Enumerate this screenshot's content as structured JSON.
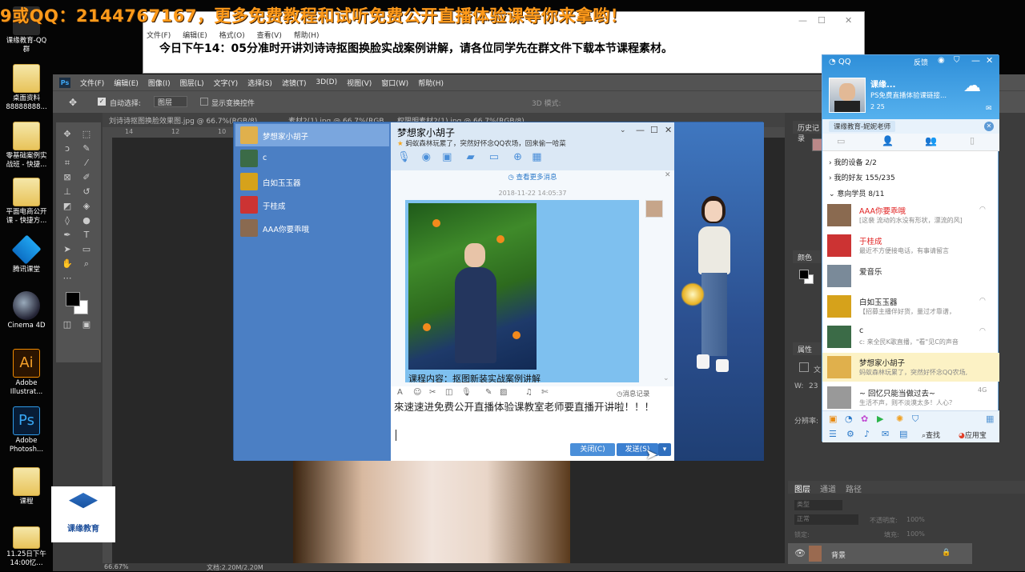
{
  "banner": "9或QQ：2144767167，更多免费教程和试听免费公开直播体验课等你来拿哟！",
  "desktop": {
    "icons": [
      {
        "label": "课缘教育-QQ群"
      },
      {
        "label": "桌面资料88888888..."
      },
      {
        "label": "零基础案例实战班 - 快捷..."
      },
      {
        "label": "平面电商公开课 - 快捷方..."
      },
      {
        "label": "腾讯课堂"
      },
      {
        "label": "Cinema 4D"
      },
      {
        "label": "Adobe Illustrat..."
      },
      {
        "label": "Adobe Photosh..."
      },
      {
        "label": "课程"
      },
      {
        "label": "11.25日下午14:00忆..."
      }
    ],
    "logo_text": "课缘教育"
  },
  "notepad": {
    "menu": [
      "文件(F)",
      "编辑(E)",
      "格式(O)",
      "查看(V)",
      "帮助(H)"
    ],
    "text": "今日下午14：05分准时开讲刘诗诗抠图换脸实战案例讲解，请各位同学先在群文件下载本节课程素材。"
  },
  "photoshop": {
    "logo": "Ps",
    "menu": [
      "文件(F)",
      "编辑(E)",
      "图像(I)",
      "图层(L)",
      "文字(Y)",
      "选择(S)",
      "滤镜(T)",
      "3D(D)",
      "视图(V)",
      "窗口(W)",
      "帮助(H)"
    ],
    "options": {
      "auto_select": "自动选择:",
      "layer": "图层",
      "show_transform": "显示变换控件",
      "mode3d": "3D 模式:"
    },
    "tabs": [
      "刘诗诗抠图换脸效果图.jpg @ 66.7%(RGB/8)",
      "素材2(1).jpg @ 66.7%(RGB/8)",
      "权限明素材2(1).jpg @ 66.7%(RGB/8)"
    ],
    "ruler": [
      "14",
      "12",
      "10"
    ],
    "status": "66.67%",
    "status_doc": "文档:2.20M/2.20M",
    "panels": {
      "history": "历史记录",
      "color": "颜色",
      "properties": "属性",
      "layers_tabs": [
        "图层",
        "通道",
        "路径"
      ],
      "kind": "类型",
      "normal": "正常",
      "opacity": "不透明度:",
      "opacity_value": "100%",
      "lock": "锁定:",
      "fill": "填充:",
      "fill_value": "100%",
      "layer_name": "背景",
      "w_label": "W:",
      "w_value": "23",
      "doc_label": "文",
      "res_label": "分辨率:"
    }
  },
  "chat": {
    "contacts": [
      {
        "name": "梦想家小胡子",
        "color": "#e0b04c"
      },
      {
        "name": "c",
        "color": "#3b6b47"
      },
      {
        "name": "白如玉玉器",
        "color": "#d6a21b"
      },
      {
        "name": "于桂成",
        "color": "#c33"
      },
      {
        "name": "AAA你要乖哦",
        "color": "#8a6a50"
      }
    ],
    "title": "梦想家小胡子",
    "signature": "蚂蚁森林玩累了，突然好怀念QQ农场，回来偷一哈菜",
    "view_more": "查看更多消息",
    "time": "2018-11-22 14:05:37",
    "bubble_text": "课程内容：抠图新装实战案例讲解",
    "msg_record": "消息记录",
    "input_text": "來速速进免费公开直播体验课教室老师要直播开讲啦！！！",
    "close_btn": "关闭(C)",
    "send_btn": "发送(S)"
  },
  "qq": {
    "title": "QQ",
    "feedback": "反馈",
    "nickname": "课缘...",
    "signature": "PS免费直播体验课链接...",
    "stats": "2  25",
    "search_value": "课缘教育-妮妮老师",
    "groups": [
      {
        "label": "我的设备 2/2"
      },
      {
        "label": "我的好友 155/235"
      },
      {
        "label": "意向学员 8/11"
      }
    ],
    "contacts": [
      {
        "name": "AAA你要乖哦",
        "status": "[这裴 流动的水没有形状，漂流的风]",
        "color": "#8a6a50",
        "vip": true
      },
      {
        "name": "于桂成",
        "status": "最近不方便接电话，有事请留言",
        "color": "#c33",
        "vip": true
      },
      {
        "name": "爱音乐",
        "status": "",
        "color": "#7a8a99",
        "vip": false
      },
      {
        "name": "白如玉玉器",
        "status": "【招募主播伴好货，量过才靠谱，",
        "color": "#d6a21b",
        "vip": false
      },
      {
        "name": "c",
        "status": "c: 来全民K歌直播，\"看\"见C的声音",
        "color": "#3b6b47",
        "vip": false
      },
      {
        "name": "梦想家小胡子",
        "status": "蚂蚁森林玩累了，突然好怀念QQ农场,",
        "color": "#e0b04c",
        "vip": false
      },
      {
        "name": "~ 回忆只能当做过去~",
        "status": "生活不声，则不淡漠太多！人心？",
        "color": "#999",
        "vip": false
      }
    ],
    "bottom_find": "查找",
    "bottom_apps": "应用宝",
    "signal_4g": "4G"
  }
}
